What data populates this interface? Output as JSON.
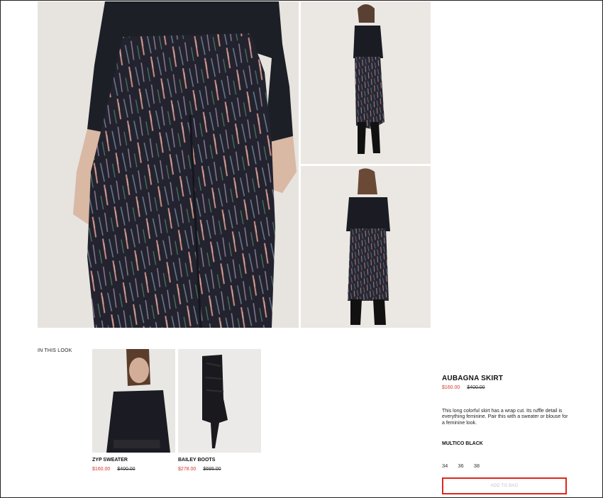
{
  "look": {
    "title": "IN THIS LOOK",
    "items": [
      {
        "name": "ZYP SWEATER",
        "sale_price": "$160.00",
        "original_price": "$400.00"
      },
      {
        "name": "BAILEY BOOTS",
        "sale_price": "$278.00",
        "original_price": "$695.00"
      }
    ]
  },
  "product": {
    "title": "AUBAGNA SKIRT",
    "sale_price": "$160.00",
    "original_price": "$400.00",
    "description": "This long colorful skirt has a wrap cut. Its ruffle detail is everything feminine. Pair this with a sweater or blouse for a feminine look.",
    "color": "MULTICO BLACK",
    "sizes": [
      "34",
      "36",
      "38"
    ],
    "add_to_bag_label": "ADD TO BAG"
  },
  "colors": {
    "sale": "#d5372b",
    "button_border": "#e0261c",
    "button_text": "#c3c3c3"
  }
}
